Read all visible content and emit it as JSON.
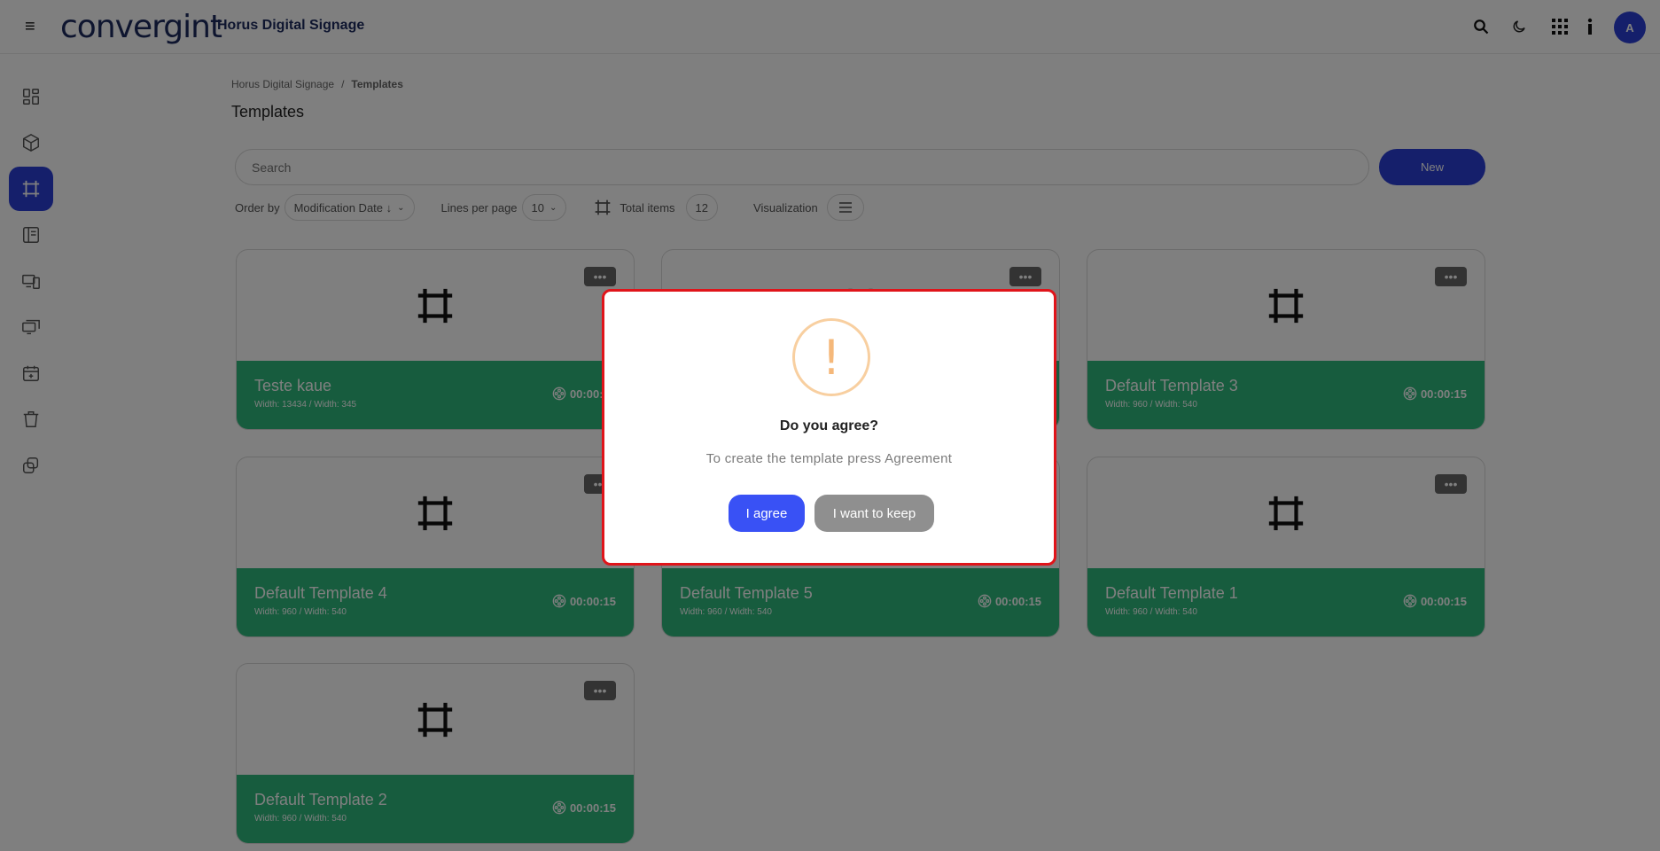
{
  "header": {
    "logo_text": "convergint",
    "app_title": "Horus Digital Signage",
    "avatar_initial": "A",
    "icons": [
      "hamburger-icon",
      "search-icon",
      "moon-icon",
      "apps-grid-icon",
      "info-icon"
    ]
  },
  "sidebar": {
    "items": [
      {
        "name": "dashboard-icon"
      },
      {
        "name": "cube-icon"
      },
      {
        "name": "templates-icon",
        "active": true
      },
      {
        "name": "playlist-icon"
      },
      {
        "name": "devices-icon"
      },
      {
        "name": "screens-icon"
      },
      {
        "name": "calendar-icon"
      },
      {
        "name": "trash-icon"
      },
      {
        "name": "copy-icon"
      }
    ]
  },
  "breadcrumb": {
    "root": "Horus Digital Signage",
    "separator": "/",
    "current": "Templates"
  },
  "page": {
    "title": "Templates"
  },
  "search": {
    "placeholder": "Search"
  },
  "new_button": "New",
  "toolbar": {
    "order_by_label": "Order by",
    "order_by_value": "Modification Date ↓",
    "lines_label": "Lines per page",
    "lines_value": "10",
    "total_label": "Total items",
    "total_value": "12",
    "visualization_label": "Visualization"
  },
  "cards": [
    {
      "name": "Teste kaue",
      "size": "Width: 13434 / Width: 345",
      "duration": "00:00:15"
    },
    {
      "name": "",
      "size": "",
      "duration": ""
    },
    {
      "name": "Default Template 3",
      "size": "Width: 960 / Width: 540",
      "duration": "00:00:15"
    },
    {
      "name": "Default Template 4",
      "size": "Width: 960 / Width: 540",
      "duration": "00:00:15"
    },
    {
      "name": "Default Template 5",
      "size": "Width: 960 / Width: 540",
      "duration": "00:00:15"
    },
    {
      "name": "Default Template 1",
      "size": "Width: 960 / Width: 540",
      "duration": "00:00:15"
    },
    {
      "name": "Default Template 2",
      "size": "Width: 960 / Width: 540",
      "duration": "00:00:15"
    }
  ],
  "modal": {
    "title": "Do you agree?",
    "text": "To create the template press Agreement",
    "agree_label": "I agree",
    "keep_label": "I want to keep",
    "icon": "!"
  },
  "colors": {
    "primary": "#2b3fd6",
    "card_footer": "#2eb87d",
    "modal_border": "#e0141a",
    "warning": "#f5b87a"
  }
}
